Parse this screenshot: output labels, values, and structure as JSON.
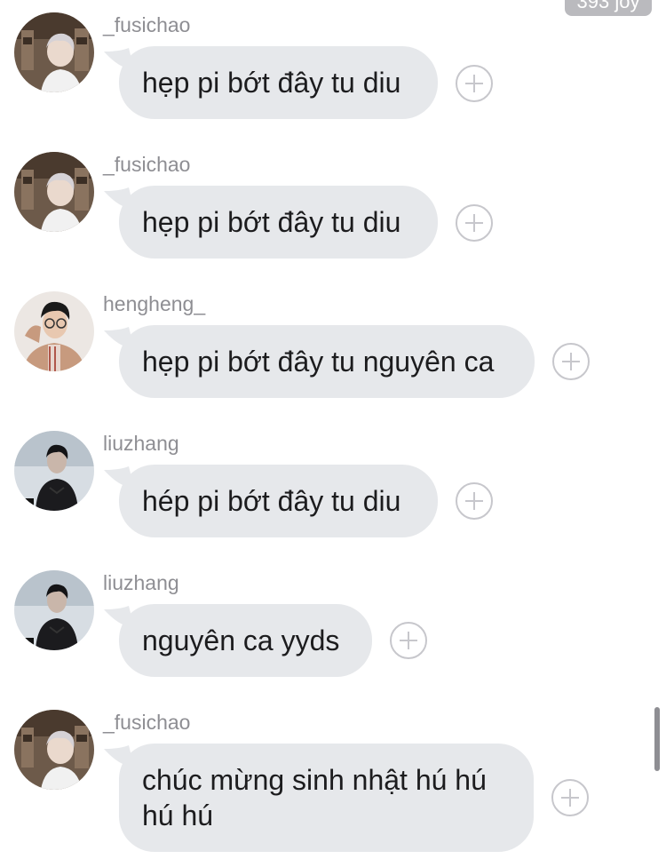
{
  "top_badge": "393 joy",
  "messages": [
    {
      "username": "_fusichao",
      "avatar": "avatar-fusichao-icon",
      "text": "hẹp pi bớt đây tu diu"
    },
    {
      "username": "_fusichao",
      "avatar": "avatar-fusichao-icon",
      "text": "hẹp pi bớt đây tu diu"
    },
    {
      "username": "hengheng_",
      "avatar": "avatar-hengheng-icon",
      "text": "hẹp pi bớt đây tu nguyên ca"
    },
    {
      "username": "liuzhang",
      "avatar": "avatar-liuzhang-icon",
      "text": "hép pi bớt đây tu diu"
    },
    {
      "username": "liuzhang",
      "avatar": "avatar-liuzhang-icon",
      "text": "nguyên ca yyds"
    },
    {
      "username": "_fusichao",
      "avatar": "avatar-fusichao-icon",
      "text_lines": [
        "chúc mừng sinh nhật hú hú",
        "hú hú"
      ]
    }
  ],
  "colors": {
    "bubble": "#e6e8eb",
    "text": "#1c1c1e",
    "username": "#8e8e93",
    "plus_icon": "#c7c7cc"
  }
}
